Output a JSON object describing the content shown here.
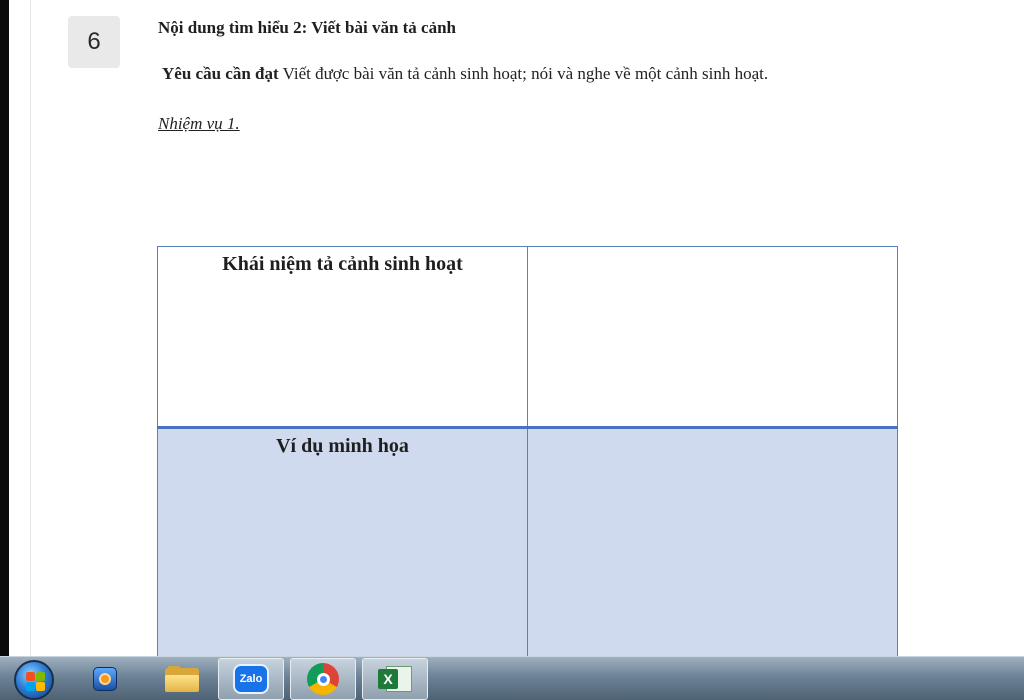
{
  "document": {
    "step_number": "6",
    "heading": "Nội dung tìm hiểu 2: Viết bài văn tả cảnh",
    "requirement_label": "Yêu cầu cần đạt",
    "requirement_text": " Viết được bài văn tả cảnh sinh hoạt; nói và nghe về một cảnh sinh hoạt.",
    "task_label": "Nhiệm vụ 1."
  },
  "table": {
    "rows": [
      {
        "label": "Khái niệm tả cảnh sinh hoạt",
        "answer": ""
      },
      {
        "label": "Ví dụ minh họa",
        "answer": ""
      }
    ]
  },
  "colors": {
    "table_border": "#5b7fbf",
    "row2_fill": "#cfdaee",
    "badge_bg": "#e9e9e9"
  },
  "taskbar": {
    "items": [
      {
        "icon": "start-orb-icon"
      },
      {
        "icon": "media-player-icon"
      },
      {
        "icon": "file-explorer-icon"
      },
      {
        "icon": "zalo-icon",
        "label": "Zalo"
      },
      {
        "icon": "chrome-icon"
      },
      {
        "icon": "excel-icon",
        "label": "X"
      }
    ]
  }
}
